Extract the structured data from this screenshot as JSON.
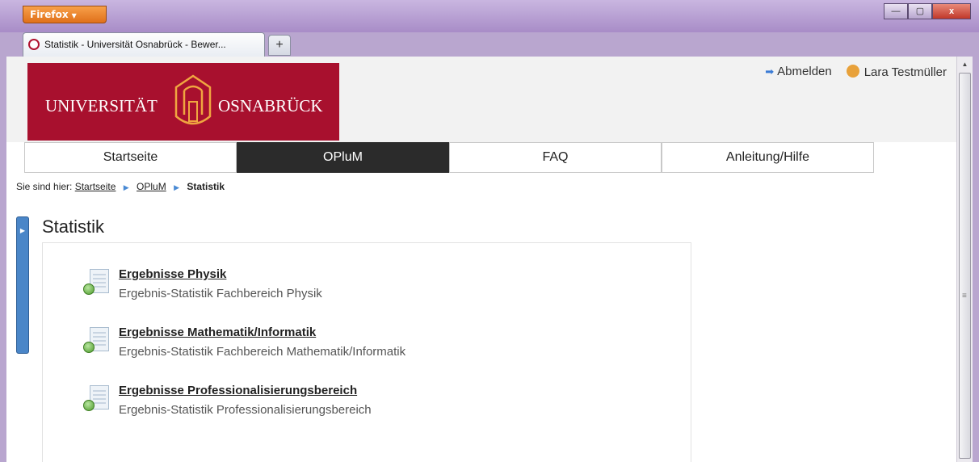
{
  "browser": {
    "app_button": "Firefox",
    "tab_title": "Statistik - Universität Osnabrück - Bewer...",
    "new_tab": "+",
    "window_controls": {
      "minimize": "—",
      "maximize": "▢",
      "close": "x"
    }
  },
  "logo": {
    "left_text": "UNIVERSITÄT",
    "right_text": "OSNABRÜCK"
  },
  "user_bar": {
    "logout_label": "Abmelden",
    "user_name": "Lara Testmüller"
  },
  "nav": {
    "items": [
      {
        "label": "Startseite",
        "active": false
      },
      {
        "label": "OPluM",
        "active": true
      },
      {
        "label": "FAQ",
        "active": false
      },
      {
        "label": "Anleitung/Hilfe",
        "active": false
      }
    ]
  },
  "breadcrumb": {
    "prefix": "Sie sind hier:",
    "items": [
      "Startseite",
      "OPluM"
    ],
    "current": "Statistik"
  },
  "page": {
    "title": "Statistik",
    "entries": [
      {
        "title": "Ergebnisse Physik",
        "description": "Ergebnis-Statistik Fachbereich Physik"
      },
      {
        "title": "Ergebnisse Mathematik/Informatik",
        "description": "Ergebnis-Statistik Fachbereich Mathematik/Informatik"
      },
      {
        "title": "Ergebnisse Professionalisierungsbereich",
        "description": "Ergebnis-Statistik Professionalisierungsbereich"
      }
    ]
  },
  "colors": {
    "brand": "#a8102e",
    "nav_active": "#2b2b2b",
    "accent": "#4a86c8"
  }
}
